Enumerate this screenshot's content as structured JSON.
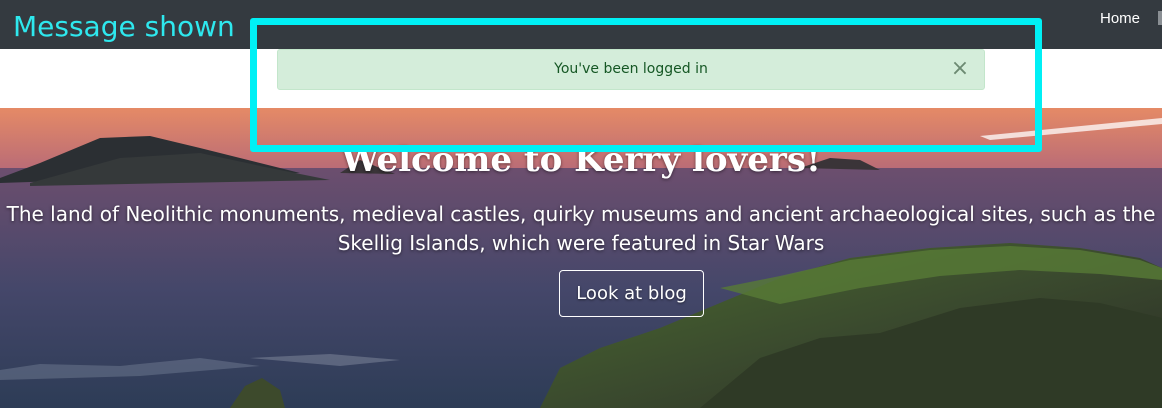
{
  "navbar": {
    "links": [
      {
        "label": "Home"
      }
    ]
  },
  "alert": {
    "message": "You've been logged in",
    "close_symbol": "×",
    "type": "success",
    "color_bg": "#d4edda",
    "color_text": "#155724"
  },
  "hero": {
    "title": "Welcome to Kerry lovers!",
    "subtitle_line1": "The land of Neolithic monuments, medieval castles, quirky museums and ancient archaeological sites, such as the",
    "subtitle_line2": "Skellig Islands, which were featured in Star Wars",
    "button_label": "Look at blog"
  },
  "annotation": {
    "label": "Message shown",
    "color": "#00f0f5"
  },
  "icons": {
    "close": "close-icon",
    "nav_overflow": "nav-overflow-icon"
  }
}
